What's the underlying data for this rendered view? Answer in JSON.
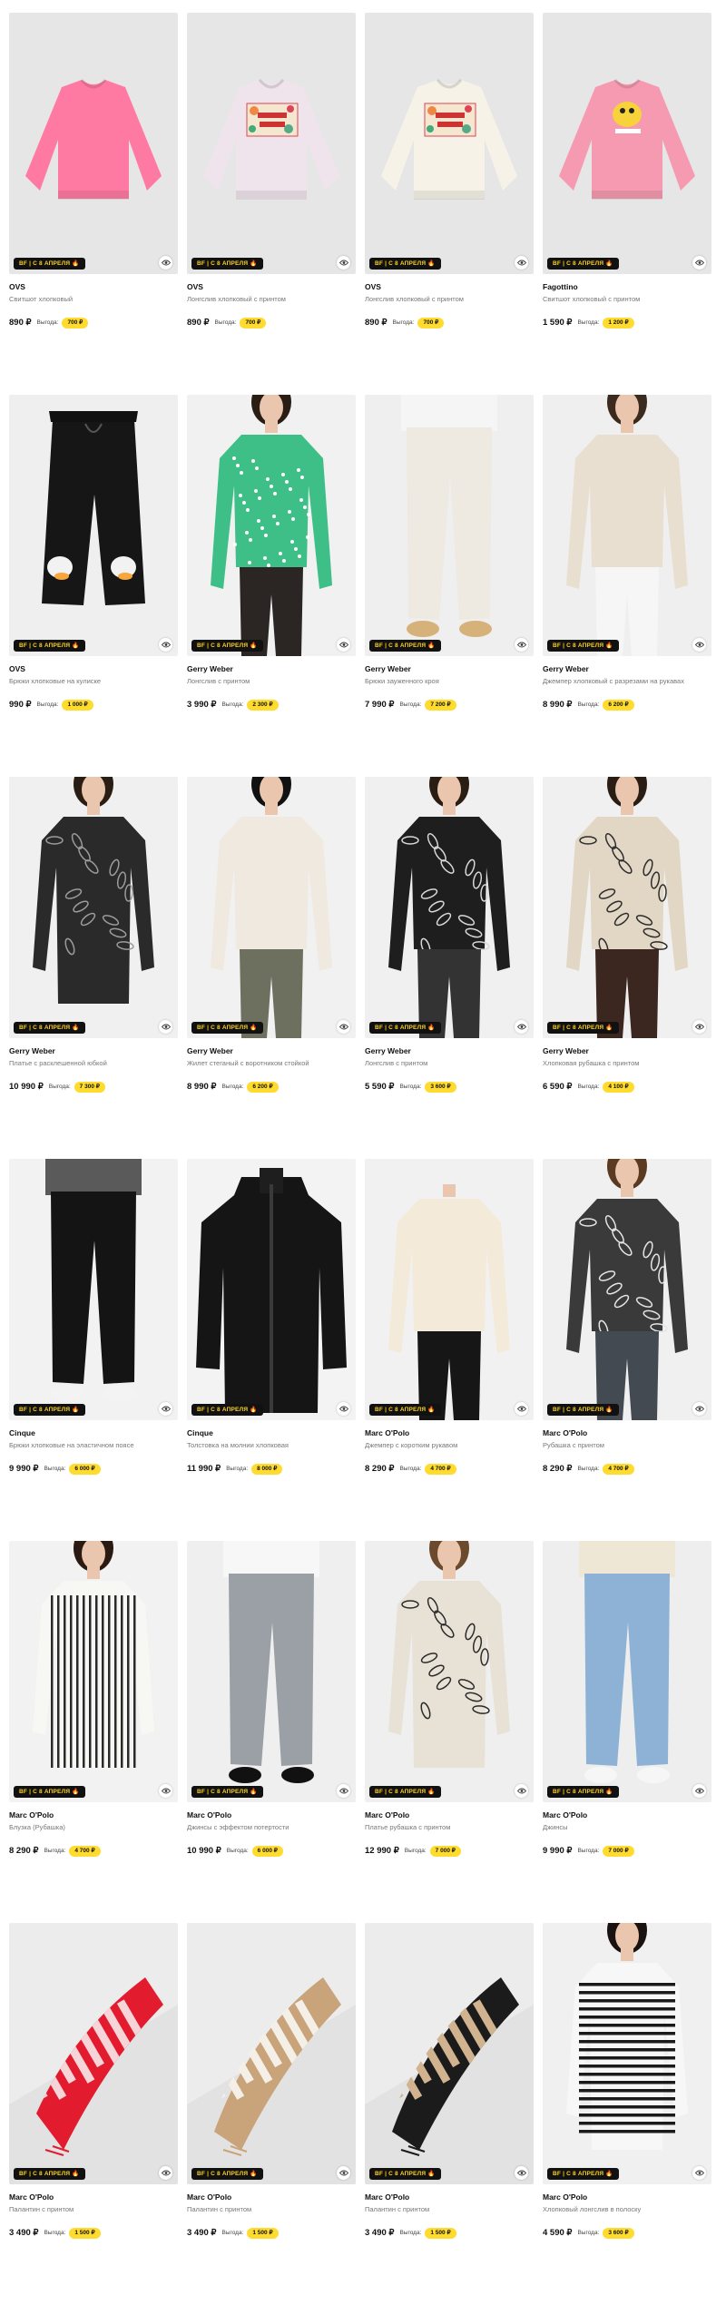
{
  "promo_label": "BF | С 8 АПРЕЛЯ 🔥",
  "benefit_label": "Выгода:",
  "products": [
    {
      "brand": "OVS",
      "name": "Свитшот хлопковый",
      "price": "890 ₽",
      "benefit": "700 ₽",
      "art": "sweat-pink"
    },
    {
      "brand": "OVS",
      "name": "Лонгслив хлопковый с принтом",
      "price": "890 ₽",
      "benefit": "700 ₽",
      "art": "sweat-lilac"
    },
    {
      "brand": "OVS",
      "name": "Лонгслив хлопковый с принтом",
      "price": "890 ₽",
      "benefit": "700 ₽",
      "art": "sweat-cream"
    },
    {
      "brand": "Fagottino",
      "name": "Свитшот хлопковый с принтом",
      "price": "1 590 ₽",
      "benefit": "1 200 ₽",
      "art": "sweat-pink2"
    },
    {
      "brand": "OVS",
      "name": "Брюки хлопковые на кулиске",
      "price": "990 ₽",
      "benefit": "1 000 ₽",
      "art": "pants-black"
    },
    {
      "brand": "Gerry Weber",
      "name": "Лонгслив с принтом",
      "price": "3 990 ₽",
      "benefit": "2 300 ₽",
      "art": "model-green"
    },
    {
      "brand": "Gerry Weber",
      "name": "Брюки зауженного кроя",
      "price": "7 990 ₽",
      "benefit": "7 200 ₽",
      "art": "model-pants-white"
    },
    {
      "brand": "Gerry Weber",
      "name": "Джемпер хлопковый с разрезами на рукавах",
      "price": "8 990 ₽",
      "benefit": "6 200 ₽",
      "art": "model-beige"
    },
    {
      "brand": "Gerry Weber",
      "name": "Платье с расклешенной юбкой",
      "price": "10 990 ₽",
      "benefit": "7 300 ₽",
      "art": "model-dress"
    },
    {
      "brand": "Gerry Weber",
      "name": "Жилет стеганый с воротником стойкой",
      "price": "8 990 ₽",
      "benefit": "6 200 ₽",
      "art": "model-vest"
    },
    {
      "brand": "Gerry Weber",
      "name": "Лонгслив с принтом",
      "price": "5 590 ₽",
      "benefit": "3 600 ₽",
      "art": "model-print-black"
    },
    {
      "brand": "Gerry Weber",
      "name": "Хлопковая рубашка с принтом",
      "price": "6 590 ₽",
      "benefit": "4 100 ₽",
      "art": "model-print-beige"
    },
    {
      "brand": "Cinque",
      "name": "Брюки хлопковые на эластичном поясе",
      "price": "9 990 ₽",
      "benefit": "6 000 ₽",
      "art": "legs-black"
    },
    {
      "brand": "Cinque",
      "name": "Толстовка на молнии хлопковая",
      "price": "11 990 ₽",
      "benefit": "8 000 ₽",
      "art": "jacket-black"
    },
    {
      "brand": "Marc O'Polo",
      "name": "Джемпер с коротким рукавом",
      "price": "8 290 ₽",
      "benefit": "4 700 ₽",
      "art": "model-cream-black"
    },
    {
      "brand": "Marc O'Polo",
      "name": "Рубашка с принтом",
      "price": "8 290 ₽",
      "benefit": "4 700 ₽",
      "art": "model-shirt-print"
    },
    {
      "brand": "Marc O'Polo",
      "name": "Блузка (Рубашка)",
      "price": "8 290 ₽",
      "benefit": "4 700 ₽",
      "art": "model-stripes"
    },
    {
      "brand": "Marc O'Polo",
      "name": "Джинсы с эффектом потертости",
      "price": "10 990 ₽",
      "benefit": "6 000 ₽",
      "art": "legs-grey"
    },
    {
      "brand": "Marc O'Polo",
      "name": "Платье рубашка с принтом",
      "price": "12 990 ₽",
      "benefit": "7 000 ₽",
      "art": "model-shirtdress"
    },
    {
      "brand": "Marc O'Polo",
      "name": "Джинсы",
      "price": "9 990 ₽",
      "benefit": "7 000 ₽",
      "art": "legs-blue"
    },
    {
      "brand": "Marc O'Polo",
      "name": "Палантин с принтом",
      "price": "3 490 ₽",
      "benefit": "1 500 ₽",
      "art": "scarf-red"
    },
    {
      "brand": "Marc O'Polo",
      "name": "Палантин с принтом",
      "price": "3 490 ₽",
      "benefit": "1 500 ₽",
      "art": "scarf-beige"
    },
    {
      "brand": "Marc O'Polo",
      "name": "Палантин с принтом",
      "price": "3 490 ₽",
      "benefit": "1 500 ₽",
      "art": "scarf-black"
    },
    {
      "brand": "Marc O'Polo",
      "name": "Хлопковый лонгслив в полоску",
      "price": "4 590 ₽",
      "benefit": "3 600 ₽",
      "art": "model-breton"
    }
  ]
}
